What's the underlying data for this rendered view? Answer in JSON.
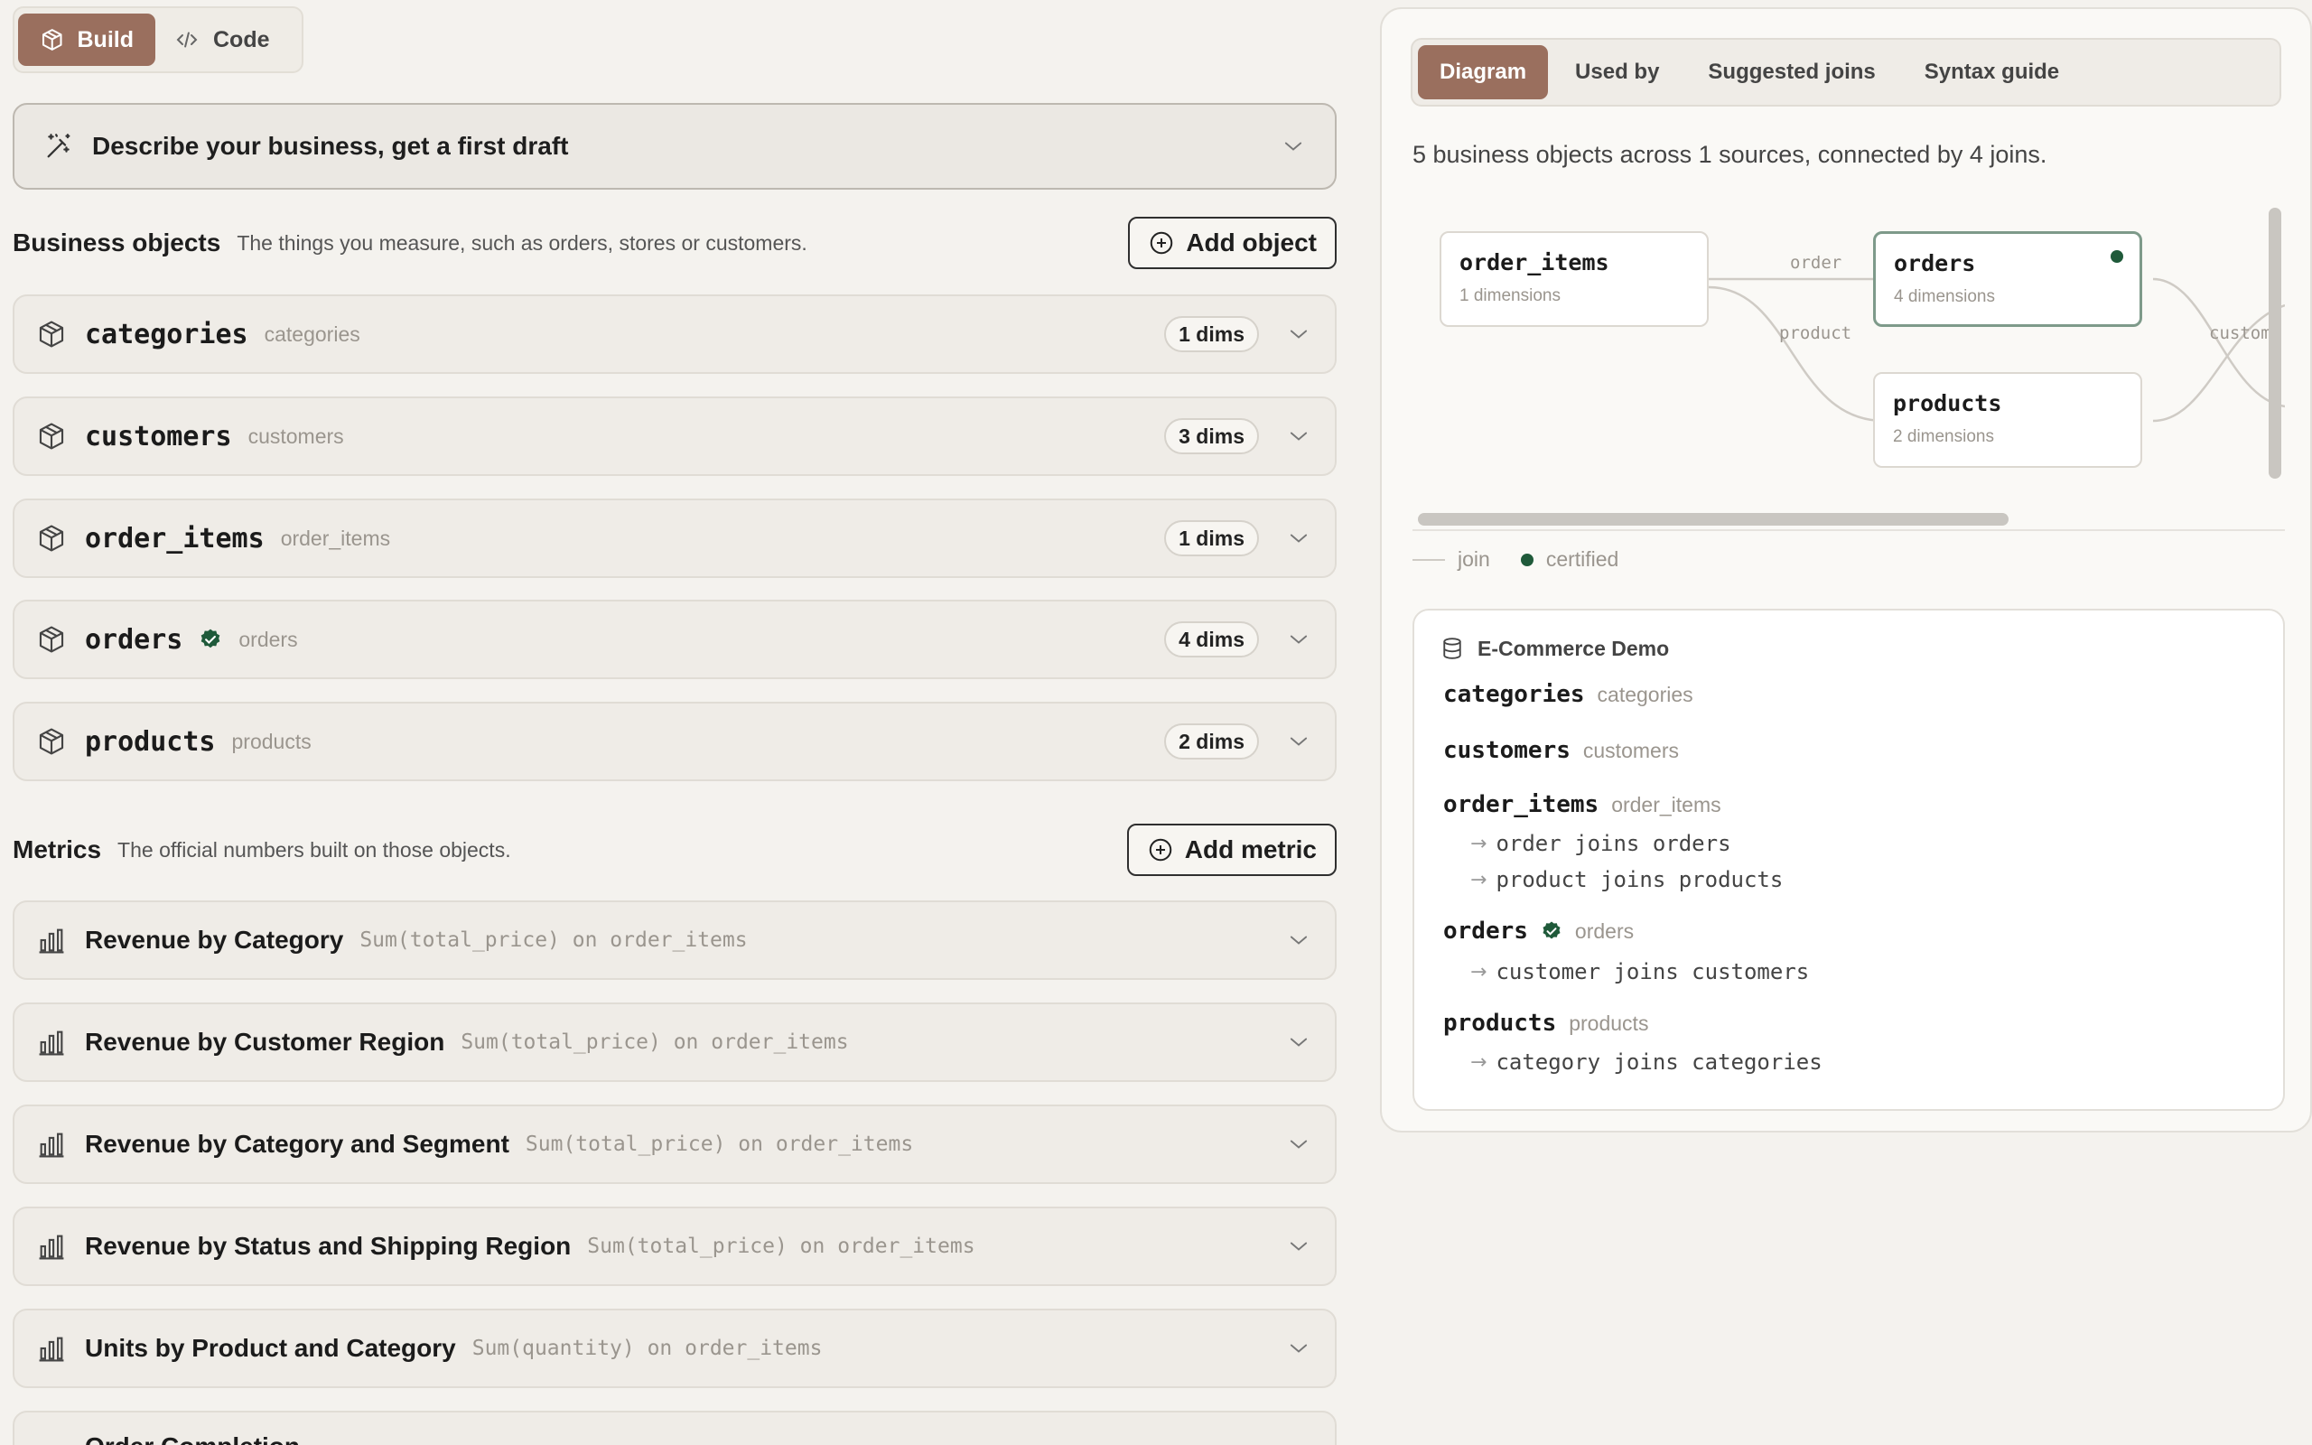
{
  "mode_toggle": {
    "build_label": "Build",
    "code_label": "Code",
    "active": "Build"
  },
  "describe": {
    "label": "Describe your business, get a first draft"
  },
  "business_objects": {
    "title": "Business objects",
    "subtitle": "The things you measure, such as orders, stores or customers.",
    "add_label": "Add object",
    "items": [
      {
        "name": "categories",
        "alias": "categories",
        "dims": "1 dims",
        "certified": false
      },
      {
        "name": "customers",
        "alias": "customers",
        "dims": "3 dims",
        "certified": false
      },
      {
        "name": "order_items",
        "alias": "order_items",
        "dims": "1 dims",
        "certified": false
      },
      {
        "name": "orders",
        "alias": "orders",
        "dims": "4 dims",
        "certified": true
      },
      {
        "name": "products",
        "alias": "products",
        "dims": "2 dims",
        "certified": false
      }
    ]
  },
  "metrics": {
    "title": "Metrics",
    "subtitle": "The official numbers built on those objects.",
    "add_label": "Add metric",
    "items": [
      {
        "name": "Revenue by Category",
        "formula": "Sum(total_price) on order_items"
      },
      {
        "name": "Revenue by Customer Region",
        "formula": "Sum(total_price) on order_items"
      },
      {
        "name": "Revenue by Category and Segment",
        "formula": "Sum(total_price) on order_items"
      },
      {
        "name": "Revenue by Status and Shipping Region",
        "formula": "Sum(total_price) on order_items"
      },
      {
        "name": "Units by Product and Category",
        "formula": "Sum(quantity) on order_items"
      },
      {
        "name": "Order Completion",
        "formula": ""
      }
    ]
  },
  "panel": {
    "tabs": [
      "Diagram",
      "Used by",
      "Suggested joins",
      "Syntax guide"
    ],
    "active_tab": "Diagram",
    "summary": "5 business objects across 1 sources, connected by 4 joins.",
    "diagram": {
      "nodes": [
        {
          "name": "order_items",
          "dims": "1 dimensions",
          "certified": false
        },
        {
          "name": "orders",
          "dims": "4 dimensions",
          "certified": true
        },
        {
          "name": "products",
          "dims": "2 dimensions",
          "certified": false
        }
      ],
      "edge_labels": [
        "order",
        "product",
        "custome"
      ]
    },
    "legend": {
      "join": "join",
      "certified": "certified"
    },
    "source": {
      "name": "E-Commerce Demo",
      "objects": [
        {
          "name": "categories",
          "alias": "categories",
          "certified": false,
          "joins": []
        },
        {
          "name": "customers",
          "alias": "customers",
          "certified": false,
          "joins": []
        },
        {
          "name": "order_items",
          "alias": "order_items",
          "certified": false,
          "joins": [
            "order joins orders",
            "product joins products"
          ]
        },
        {
          "name": "orders",
          "alias": "orders",
          "certified": true,
          "joins": [
            "customer joins customers"
          ]
        },
        {
          "name": "products",
          "alias": "products",
          "certified": false,
          "joins": [
            "category joins categories"
          ]
        }
      ]
    }
  },
  "colors": {
    "accent": "#9a6f5e",
    "certified": "#1f5a3a",
    "background": "#f4f2ee"
  }
}
